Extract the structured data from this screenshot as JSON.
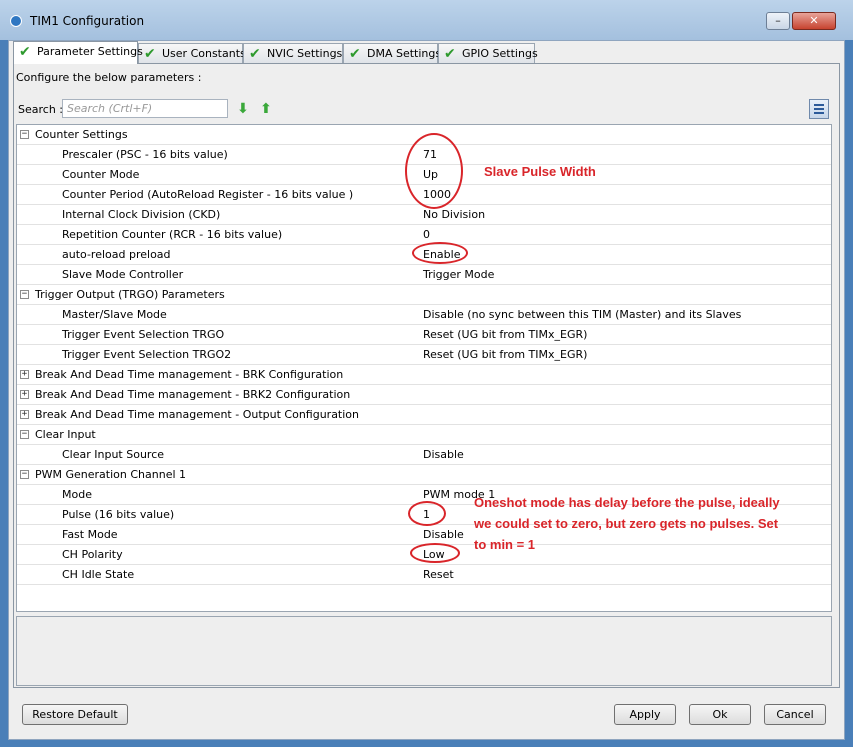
{
  "window": {
    "title": "TIM1 Configuration",
    "minimize_glyph": "–",
    "close_glyph": "✕"
  },
  "tabs": [
    {
      "label": "Parameter Settings"
    },
    {
      "label": "User Constants"
    },
    {
      "label": "NVIC Settings"
    },
    {
      "label": "DMA Settings"
    },
    {
      "label": "GPIO Settings"
    }
  ],
  "panel": {
    "configure_text": "Configure the below parameters :",
    "search_label": "Search :",
    "search_placeholder": "Search (Crtl+F)",
    "search_value": ""
  },
  "groups": {
    "counter": {
      "toggle": "−",
      "name": "Counter Settings",
      "params": [
        {
          "name": "Prescaler (PSC - 16 bits value)",
          "value": "71"
        },
        {
          "name": "Counter Mode",
          "value": "Up"
        },
        {
          "name": "Counter Period (AutoReload Register - 16 bits value )",
          "value": "1000"
        },
        {
          "name": "Internal Clock Division (CKD)",
          "value": "No Division"
        },
        {
          "name": "Repetition Counter (RCR - 16 bits value)",
          "value": "0"
        },
        {
          "name": "auto-reload preload",
          "value": "Enable"
        },
        {
          "name": "Slave Mode Controller",
          "value": "Trigger Mode"
        }
      ]
    },
    "trgo": {
      "toggle": "−",
      "name": "Trigger Output (TRGO) Parameters",
      "params": [
        {
          "name": "Master/Slave Mode",
          "value": "Disable (no sync between this TIM (Master) and its Slaves"
        },
        {
          "name": "Trigger Event Selection TRGO",
          "value": "Reset (UG bit from TIMx_EGR)"
        },
        {
          "name": "Trigger Event Selection TRGO2",
          "value": "Reset (UG bit from TIMx_EGR)"
        }
      ]
    },
    "brk": {
      "toggle": "+",
      "name": "Break And Dead Time management - BRK Configuration"
    },
    "brk2": {
      "toggle": "+",
      "name": "Break And Dead Time management - BRK2 Configuration"
    },
    "output": {
      "toggle": "+",
      "name": "Break And Dead Time management - Output Configuration"
    },
    "clear_input": {
      "toggle": "−",
      "name": "Clear Input",
      "params": [
        {
          "name": "Clear Input Source",
          "value": "Disable"
        }
      ]
    },
    "pwm": {
      "toggle": "−",
      "name": "PWM Generation Channel 1",
      "params": [
        {
          "name": "Mode",
          "value": "PWM mode 1"
        },
        {
          "name": "Pulse (16 bits value)",
          "value": "1"
        },
        {
          "name": "Fast Mode",
          "value": "Disable"
        },
        {
          "name": "CH Polarity",
          "value": "Low"
        },
        {
          "name": "CH Idle State",
          "value": "Reset"
        }
      ]
    }
  },
  "annotations": {
    "slave_pulse_width": "Slave Pulse Width",
    "oneshot_line1": "Oneshot mode has delay before the pulse, ideally",
    "oneshot_line2": "we could set to zero, but zero gets no pulses. Set",
    "oneshot_line3": "to min = 1"
  },
  "buttons": {
    "restore_default": "Restore Default",
    "apply": "Apply",
    "ok": "Ok",
    "cancel": "Cancel"
  },
  "colors": {
    "annotation_red": "#d9252a",
    "check_green": "#2e9a2e"
  }
}
